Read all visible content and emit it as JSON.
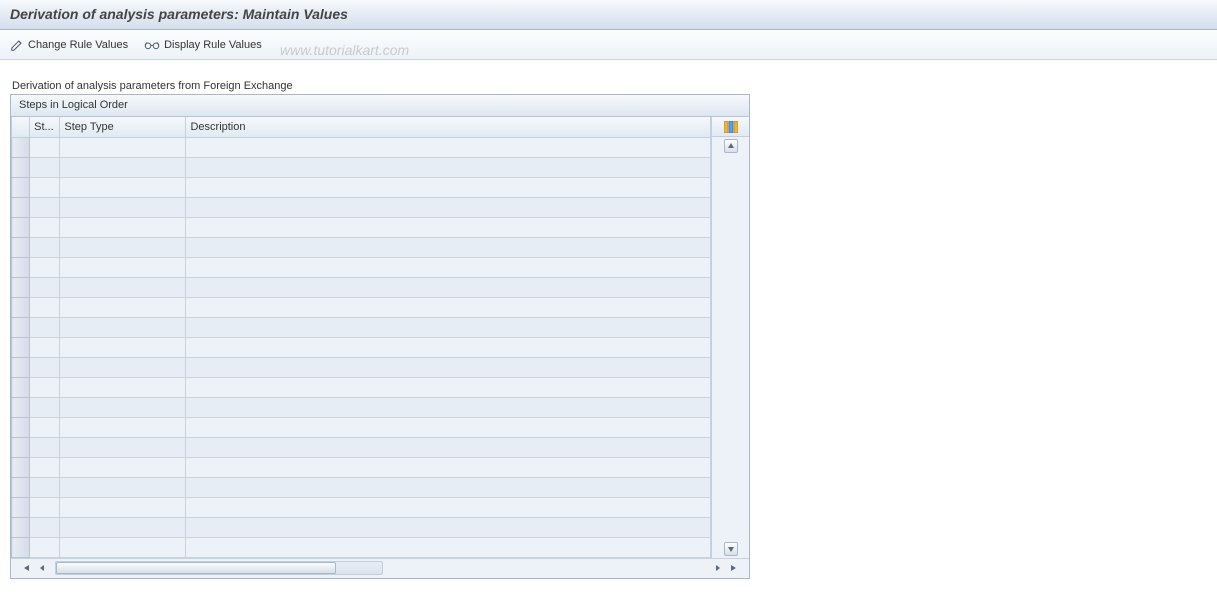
{
  "titlebar": {
    "title": "Derivation of analysis parameters: Maintain Values"
  },
  "toolbar": {
    "change_label": "Change Rule Values",
    "display_label": "Display Rule Values"
  },
  "watermark": "www.tutorialkart.com",
  "section_label": "Derivation of analysis parameters from Foreign Exchange",
  "panel": {
    "header": "Steps in Logical Order",
    "columns": {
      "st": "St...",
      "step_type": "Step Type",
      "description": "Description"
    },
    "rows": [
      {
        "st": "",
        "step_type": "",
        "description": ""
      },
      {
        "st": "",
        "step_type": "",
        "description": ""
      },
      {
        "st": "",
        "step_type": "",
        "description": ""
      },
      {
        "st": "",
        "step_type": "",
        "description": ""
      },
      {
        "st": "",
        "step_type": "",
        "description": ""
      },
      {
        "st": "",
        "step_type": "",
        "description": ""
      },
      {
        "st": "",
        "step_type": "",
        "description": ""
      },
      {
        "st": "",
        "step_type": "",
        "description": ""
      },
      {
        "st": "",
        "step_type": "",
        "description": ""
      },
      {
        "st": "",
        "step_type": "",
        "description": ""
      },
      {
        "st": "",
        "step_type": "",
        "description": ""
      },
      {
        "st": "",
        "step_type": "",
        "description": ""
      },
      {
        "st": "",
        "step_type": "",
        "description": ""
      },
      {
        "st": "",
        "step_type": "",
        "description": ""
      },
      {
        "st": "",
        "step_type": "",
        "description": ""
      },
      {
        "st": "",
        "step_type": "",
        "description": ""
      },
      {
        "st": "",
        "step_type": "",
        "description": ""
      },
      {
        "st": "",
        "step_type": "",
        "description": ""
      },
      {
        "st": "",
        "step_type": "",
        "description": ""
      },
      {
        "st": "",
        "step_type": "",
        "description": ""
      },
      {
        "st": "",
        "step_type": "",
        "description": ""
      }
    ]
  }
}
